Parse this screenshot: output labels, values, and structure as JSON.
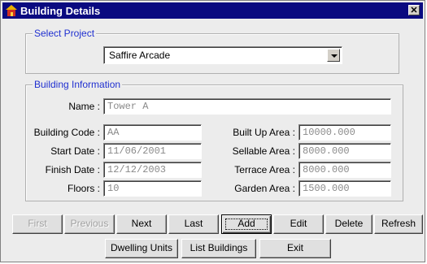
{
  "window": {
    "title": "Building Details",
    "close_label": "✕"
  },
  "select_project": {
    "legend": "Select Project",
    "selected": "Saffire Arcade"
  },
  "building_info": {
    "legend": "Building Information",
    "name_label": "Name :",
    "name_value": "Tower A",
    "building_code_label": "Building Code :",
    "building_code_value": "AA",
    "start_date_label": "Start Date :",
    "start_date_value": "11/06/2001",
    "finish_date_label": "Finish Date :",
    "finish_date_value": "12/12/2003",
    "floors_label": "Floors :",
    "floors_value": "10",
    "built_up_area_label": "Built Up Area :",
    "built_up_area_value": "10000.000",
    "sellable_area_label": "Sellable Area :",
    "sellable_area_value": "8000.000",
    "terrace_area_label": "Terrace Area :",
    "terrace_area_value": "8000.000",
    "garden_area_label": "Garden Area :",
    "garden_area_value": "1500.000"
  },
  "nav_buttons": {
    "first_label": "First",
    "previous_label": "Previous",
    "next_label": "Next",
    "last_label": "Last",
    "add_label": "Add",
    "edit_label": "Edit",
    "delete_label": "Delete",
    "refresh_label": "Refresh"
  },
  "bottom_buttons": {
    "dwelling_units_label": "Dwelling Units",
    "list_buildings_label": "List Buildings",
    "exit_label": "Exit"
  },
  "icons": [
    "building-icon",
    "close-icon",
    "dropdown-arrow-icon"
  ],
  "colors": {
    "title_bar": "#0a0a80",
    "legend_text": "#2030d0",
    "disabled_text": "#a0a0a0"
  }
}
